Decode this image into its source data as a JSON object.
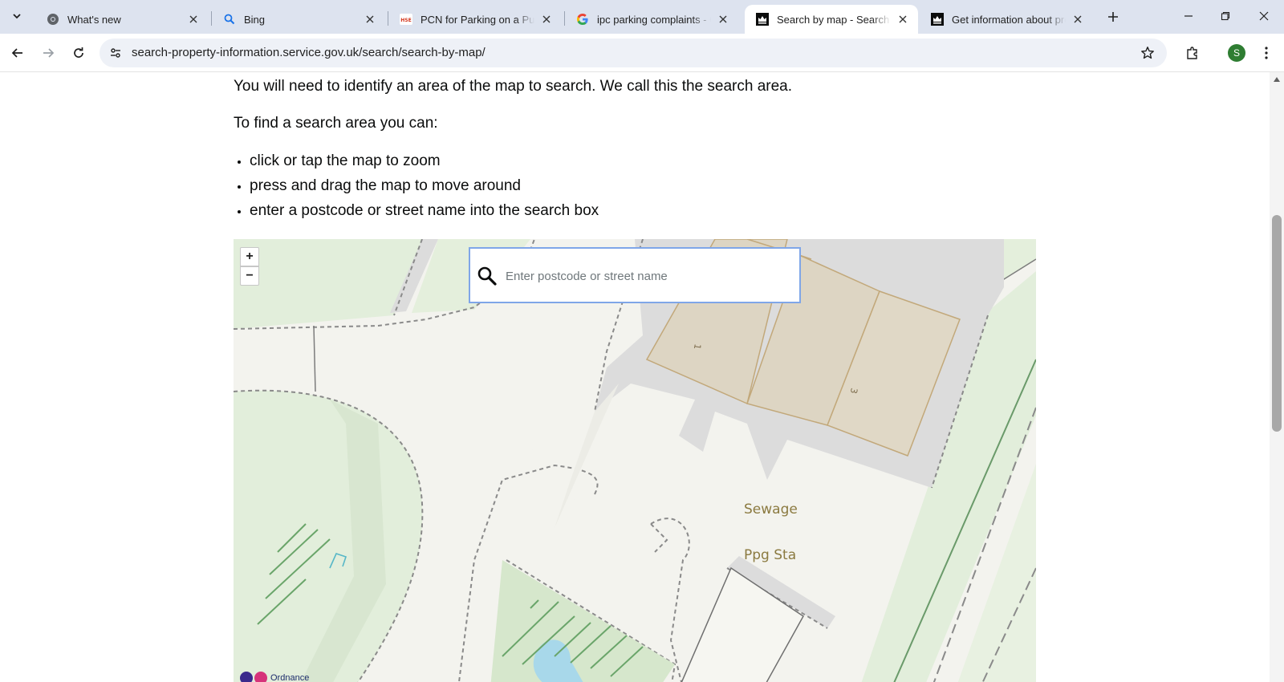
{
  "browser": {
    "tabs": [
      {
        "title": "What's new",
        "icon": "chrome-icon",
        "active": false
      },
      {
        "title": "Bing",
        "icon": "search-icon",
        "active": false
      },
      {
        "title": "PCN for Parking on a Public Road",
        "icon": "hse-icon",
        "active": false
      },
      {
        "title": "ipc parking complaints - Google Search",
        "icon": "google-icon",
        "active": false
      },
      {
        "title": "Search by map - Search for land and property information",
        "icon": "crown-icon",
        "active": true
      },
      {
        "title": "Get information about property and land",
        "icon": "crown-icon",
        "active": false
      }
    ],
    "favicon_text": {
      "hse": "HSE"
    },
    "url": "search-property-information.service.gov.uk/search/search-by-map/",
    "profile_initial": "S",
    "profile_color": "#2e7d32"
  },
  "page": {
    "intro": "You will need to identify an area of the map to search. We call this the search area.",
    "lead": "To find a search area you can:",
    "bullets": [
      "click or tap the map to zoom",
      "press and drag the map to move around",
      "enter a postcode or street name into the search box"
    ]
  },
  "map": {
    "zoom_in": "+",
    "zoom_out": "−",
    "search_placeholder": "Enter postcode or street name",
    "labels": {
      "sewage": "Sewage",
      "ppg": "Ppg Sta",
      "building_1": "1",
      "building_3": "3"
    },
    "attribution": "Ordnance",
    "colors": {
      "grass": "#e2eedb",
      "building": "#ddd5c3",
      "road": "#dcdcdc",
      "water": "#a8d8ea",
      "label": "#8b7a40"
    }
  }
}
